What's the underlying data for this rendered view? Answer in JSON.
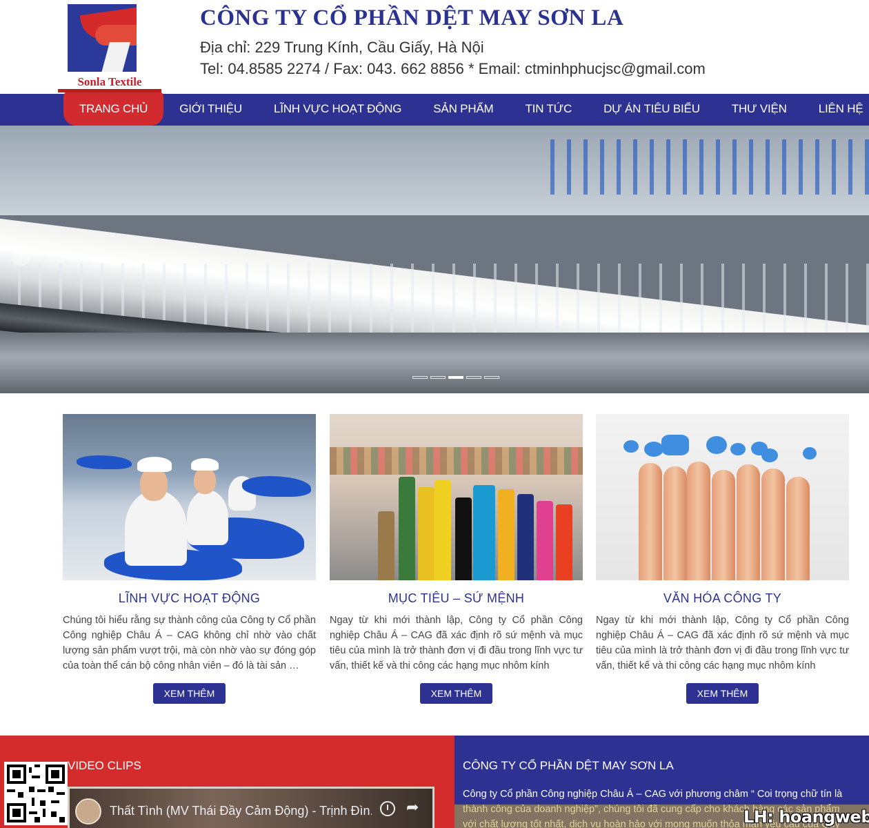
{
  "header": {
    "logo_text": "Sonla Textile",
    "company_name": "CÔNG TY CỔ PHẦN DỆT MAY SƠN LA",
    "address": "Địa chỉ: 229 Trung Kính, Cầu Giấy, Hà Nội",
    "contact": "Tel: 04.8585 2274 / Fax: 043. 662 8856 * Email: ctminhphucjsc@gmail.com"
  },
  "nav": {
    "items": [
      {
        "label": "TRANG CHỦ",
        "active": true
      },
      {
        "label": "GIỚI THIỆU"
      },
      {
        "label": "LĨNH VỰC HOẠT ĐỘNG"
      },
      {
        "label": "SẢN PHẨM"
      },
      {
        "label": "TIN TỨC"
      },
      {
        "label": "DỰ ÁN TIÊU BIỂU"
      },
      {
        "label": "THƯ VIỆN"
      },
      {
        "label": "LIÊN HỆ"
      }
    ]
  },
  "slider": {
    "prev_icon": "chevron-left-icon",
    "dot_count": 5,
    "active_dot": 3
  },
  "cards": [
    {
      "title": "LĨNH VỰC HOẠT ĐỘNG",
      "text": "Chúng tôi hiểu rằng sự thành công của Công ty Cổ phần Công nghiệp Châu Á  – CAG không chỉ nhờ vào chất lượng sản phẩm vượt trội, mà còn nhờ vào sự đóng góp của toàn thể cán bộ công nhân viên – đó là tài sản …",
      "button": "XEM THÊM"
    },
    {
      "title": "MỤC TIÊU – SỨ MỆNH",
      "text": "Ngay từ khi mới thành lập, Công ty Cổ phần Công nghiệp Châu Á – CAG đã xác định rõ sứ mệnh và mục tiêu của mình là trở thành đơn vị đi đầu trong lĩnh vực tư vấn, thiết kế và thi công các hạng mục nhôm kính",
      "button": "XEM THÊM"
    },
    {
      "title": "VĂN HÓA CÔNG TY",
      "text": "Ngay từ khi mới thành lập, Công ty Cổ phần Công nghiệp Châu Á – CAG đã xác định rõ sứ mệnh và mục tiêu của mình là trở thành đơn vị đi đầu trong lĩnh vực tư vấn, thiết kế và thi công các hạng mục nhôm kính",
      "button": "XEM THÊM"
    }
  ],
  "footer": {
    "video_heading": "VIDEO CLIPS",
    "video_title": "Thất Tình (MV Thái Đầy Cảm Động) - Trịnh Đìn...",
    "company_heading": "CÔNG TY CỔ PHẦN DỆT MAY SƠN LA",
    "company_text": "Công ty Cổ phần Công nghiệp Châu Á – CAG với phương châm “ Coi trọng chữ tín là thành công của doanh nghiệp”, chúng tôi đã cung cấp cho khách hàng các sản phẩm với chất lượng tốt nhất, dịch vụ hoàn hảo với mong muốn thỏa mãn yêu cầu của Quý"
  },
  "watermark": "LH: hoangweb.net",
  "colors": {
    "primary_blue": "#2d3192",
    "accent_red": "#d42b2c"
  }
}
